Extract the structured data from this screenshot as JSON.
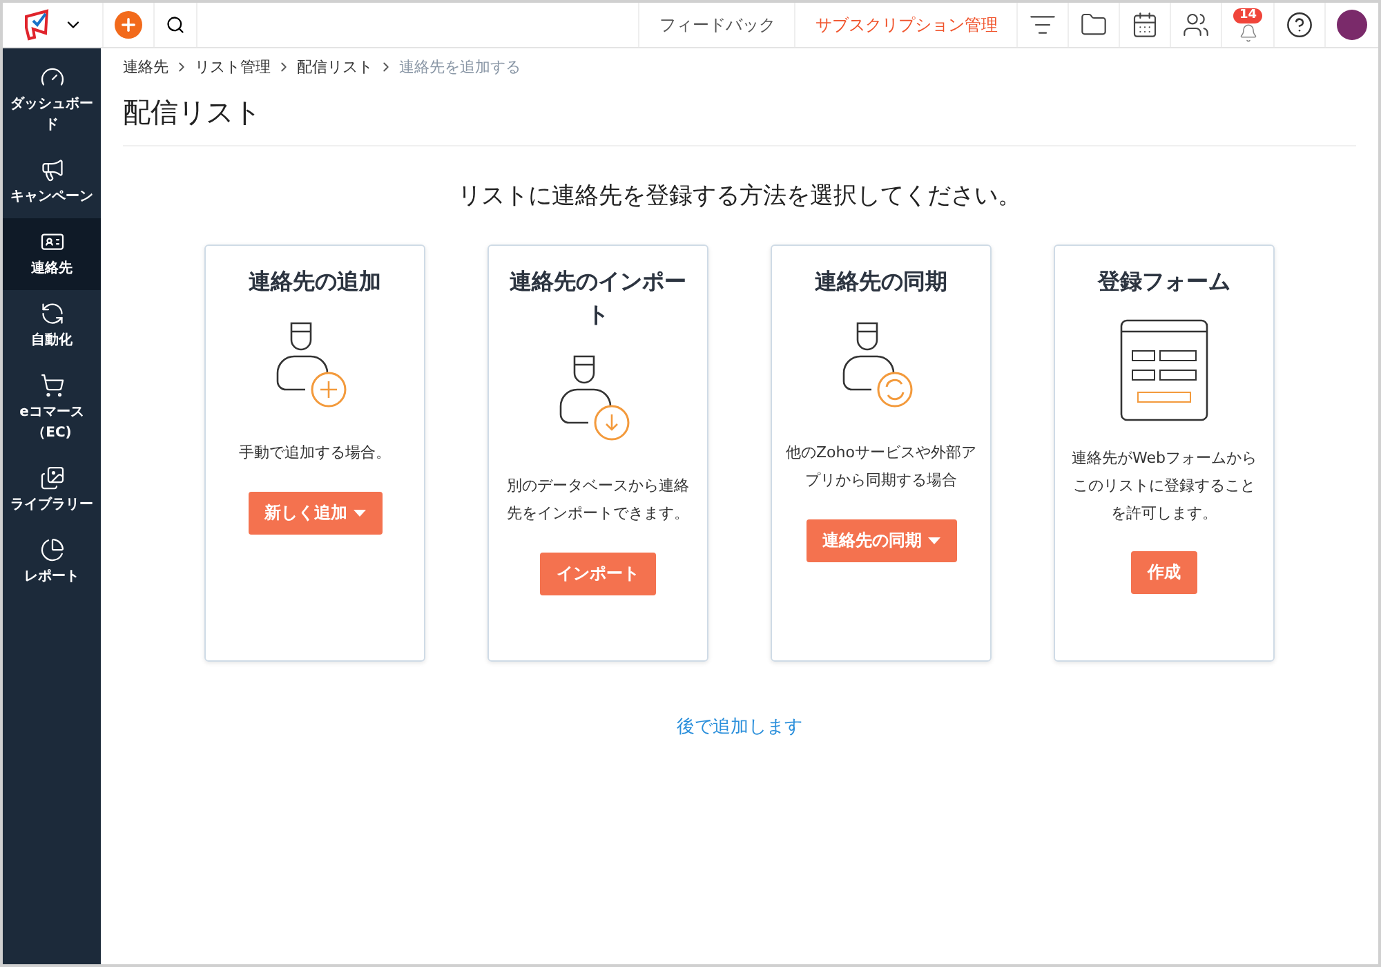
{
  "topbar": {
    "feedback": "フィードバック",
    "subscription": "サブスクリプション管理",
    "notification_count": "14"
  },
  "sidebar": {
    "items": [
      {
        "label": "ダッシュボード",
        "selected": false
      },
      {
        "label": "キャンペーン",
        "selected": false
      },
      {
        "label": "連絡先",
        "selected": true
      },
      {
        "label": "自動化",
        "selected": false
      },
      {
        "label": "eコマース（EC)",
        "selected": false
      },
      {
        "label": "ライブラリー",
        "selected": false
      },
      {
        "label": "レポート",
        "selected": false
      }
    ]
  },
  "breadcrumb": [
    "連絡先",
    "リスト管理",
    "配信リスト",
    "連絡先を追加する"
  ],
  "page_title": "配信リスト",
  "prompt": "リストに連絡先を登録する方法を選択してください。",
  "cards": [
    {
      "title": "連絡先の追加",
      "description": "手動で追加する場合。",
      "button": {
        "label": "新しく追加",
        "kind": "dropdown"
      }
    },
    {
      "title": "連絡先のインポート",
      "description": "別のデータベースから連絡先をインポートできます。",
      "button": {
        "label": "インポート",
        "kind": "plain"
      }
    },
    {
      "title": "連絡先の同期",
      "description": "他のZohoサービスや外部アプリから同期する場合",
      "button": {
        "label": "連絡先の同期",
        "kind": "dropdown"
      }
    },
    {
      "title": "登録フォーム",
      "description": "連絡先がWebフォームからこのリストに登録することを許可します。",
      "button": {
        "label": "作成",
        "kind": "plain"
      }
    }
  ],
  "later_link": "後で追加します"
}
